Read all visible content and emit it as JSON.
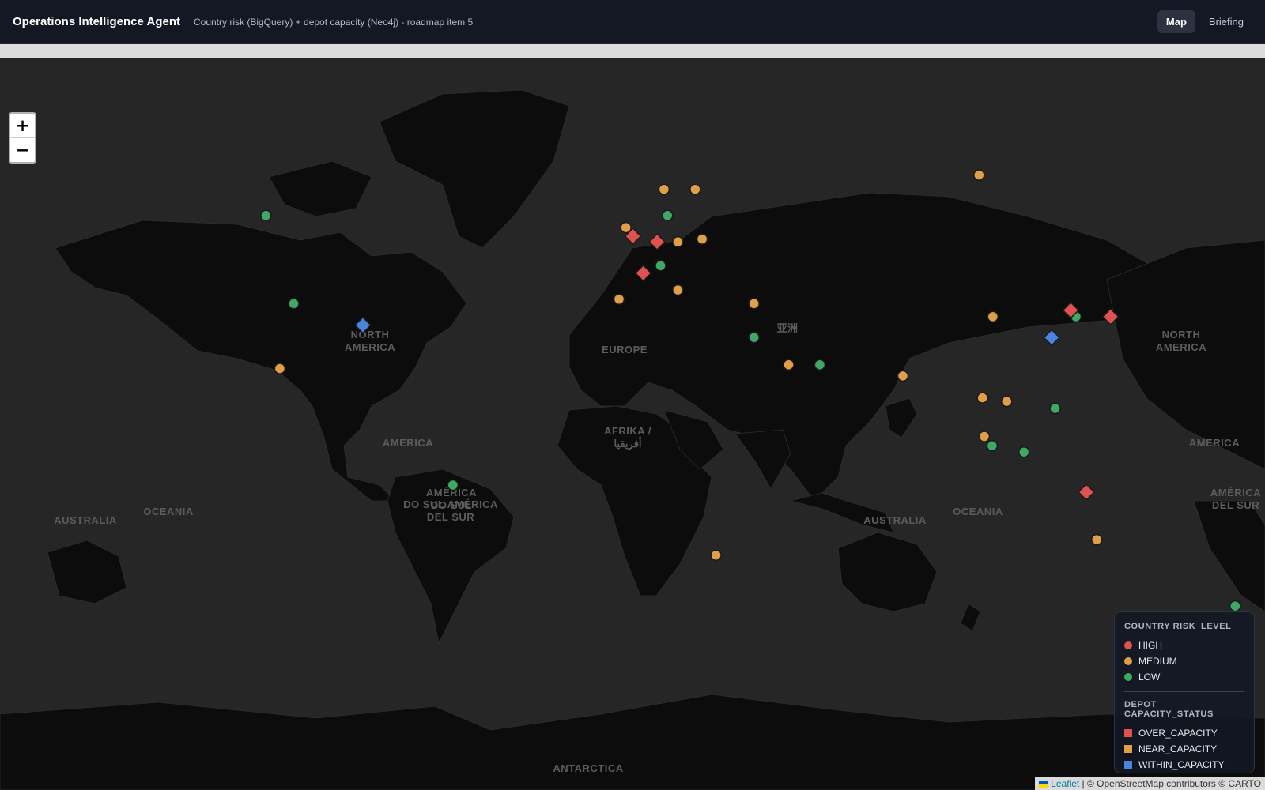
{
  "header": {
    "title": "Operations Intelligence Agent",
    "subtitle": "Country risk (BigQuery) + depot capacity (Neo4j) - roadmap item 5",
    "tabs": [
      {
        "label": "Map",
        "active": true
      },
      {
        "label": "Briefing",
        "active": false
      }
    ]
  },
  "map": {
    "zoom_in_label": "+",
    "zoom_out_label": "−",
    "region_labels": [
      {
        "text": "NORTH\nAMERICA"
      },
      {
        "text": "NORTH\nAMERICA"
      },
      {
        "text": "AMERICA"
      },
      {
        "text": "AMERICA"
      },
      {
        "text": "AMÉRICA\nDO SUL"
      },
      {
        "text": "AMÉRICA\nDEL SUR"
      },
      {
        "text": "DO SUL AMÉRICA\nDEL SUR"
      },
      {
        "text": "EUROPE"
      },
      {
        "text": "AFRIKA /\nأفريقيا"
      },
      {
        "text": "亚洲"
      },
      {
        "text": "AUSTRALIA"
      },
      {
        "text": "AUSTRALIA"
      },
      {
        "text": "OCEANIA"
      },
      {
        "text": "OCEANIA"
      },
      {
        "text": "ANTARCTICA"
      }
    ],
    "country_markers": [
      {
        "lat": 56,
        "lon": -106,
        "risk": "LOW"
      },
      {
        "lat": 39,
        "lon": -98,
        "risk": "LOW"
      },
      {
        "lat": 23,
        "lon": -102,
        "risk": "MEDIUM"
      },
      {
        "lat": -10,
        "lon": -52,
        "risk": "LOW"
      },
      {
        "lat": -29,
        "lon": 24,
        "risk": "MEDIUM"
      },
      {
        "lat": 54,
        "lon": -2,
        "risk": "MEDIUM"
      },
      {
        "lat": 60,
        "lon": 9,
        "risk": "MEDIUM"
      },
      {
        "lat": 60,
        "lon": 18,
        "risk": "MEDIUM"
      },
      {
        "lat": 56,
        "lon": 10,
        "risk": "LOW"
      },
      {
        "lat": 52,
        "lon": 20,
        "risk": "MEDIUM"
      },
      {
        "lat": 51.5,
        "lon": 13,
        "risk": "MEDIUM"
      },
      {
        "lat": 47,
        "lon": 8,
        "risk": "LOW"
      },
      {
        "lat": 42,
        "lon": 13,
        "risk": "MEDIUM"
      },
      {
        "lat": 40,
        "lon": -4,
        "risk": "MEDIUM"
      },
      {
        "lat": 39,
        "lon": 35,
        "risk": "MEDIUM"
      },
      {
        "lat": 31,
        "lon": 35,
        "risk": "LOW"
      },
      {
        "lat": 24,
        "lon": 45,
        "risk": "MEDIUM"
      },
      {
        "lat": 24,
        "lon": 54,
        "risk": "LOW"
      },
      {
        "lat": 21,
        "lon": 78,
        "risk": "MEDIUM"
      },
      {
        "lat": 62,
        "lon": 100,
        "risk": "MEDIUM"
      },
      {
        "lat": 36,
        "lon": 104,
        "risk": "MEDIUM"
      },
      {
        "lat": 15,
        "lon": 101,
        "risk": "MEDIUM"
      },
      {
        "lat": 14,
        "lon": 108,
        "risk": "MEDIUM"
      },
      {
        "lat": 12,
        "lon": 122,
        "risk": "LOW"
      },
      {
        "lat": 4,
        "lon": 101.5,
        "risk": "MEDIUM"
      },
      {
        "lat": 1.3,
        "lon": 103.8,
        "risk": "LOW"
      },
      {
        "lat": -0.5,
        "lon": 113,
        "risk": "LOW"
      },
      {
        "lat": 36,
        "lon": 128,
        "risk": "LOW"
      },
      {
        "lat": -25,
        "lon": 134,
        "risk": "MEDIUM"
      },
      {
        "lat": -41,
        "lon": 174,
        "risk": "LOW"
      }
    ],
    "depot_markers": [
      {
        "lat": 34,
        "lon": -78,
        "status": "WITHIN_CAPACITY"
      },
      {
        "lat": 52.5,
        "lon": 0,
        "status": "OVER_CAPACITY"
      },
      {
        "lat": 51.5,
        "lon": 7,
        "status": "OVER_CAPACITY"
      },
      {
        "lat": 45.5,
        "lon": 3,
        "status": "OVER_CAPACITY"
      },
      {
        "lat": 37.5,
        "lon": 126.5,
        "status": "OVER_CAPACITY"
      },
      {
        "lat": 36,
        "lon": 138,
        "status": "OVER_CAPACITY"
      },
      {
        "lat": 31,
        "lon": 121,
        "status": "WITHIN_CAPACITY"
      },
      {
        "lat": -12,
        "lon": 131,
        "status": "OVER_CAPACITY"
      }
    ]
  },
  "legend": {
    "risk_title": "COUNTRY RISK_LEVEL",
    "risk_items": [
      {
        "label": "HIGH",
        "color": "#e05252"
      },
      {
        "label": "MEDIUM",
        "color": "#e09d4a"
      },
      {
        "label": "LOW",
        "color": "#3fa865"
      }
    ],
    "capacity_title": "DEPOT CAPACITY_STATUS",
    "capacity_items": [
      {
        "label": "OVER_CAPACITY",
        "color": "#e05252"
      },
      {
        "label": "NEAR_CAPACITY",
        "color": "#e09d4a"
      },
      {
        "label": "WITHIN_CAPACITY",
        "color": "#4a84e0"
      }
    ]
  },
  "attribution": {
    "leaflet": "Leaflet",
    "rest": "| © OpenStreetMap contributors © CARTO"
  },
  "colors": {
    "ocean": "#262626",
    "land": "#0c0c0c",
    "border": "#2e2e2e",
    "HIGH": "#e05252",
    "MEDIUM": "#e09d4a",
    "LOW": "#3fa865",
    "OVER_CAPACITY": "#e05252",
    "NEAR_CAPACITY": "#e09d4a",
    "WITHIN_CAPACITY": "#4a84e0"
  }
}
